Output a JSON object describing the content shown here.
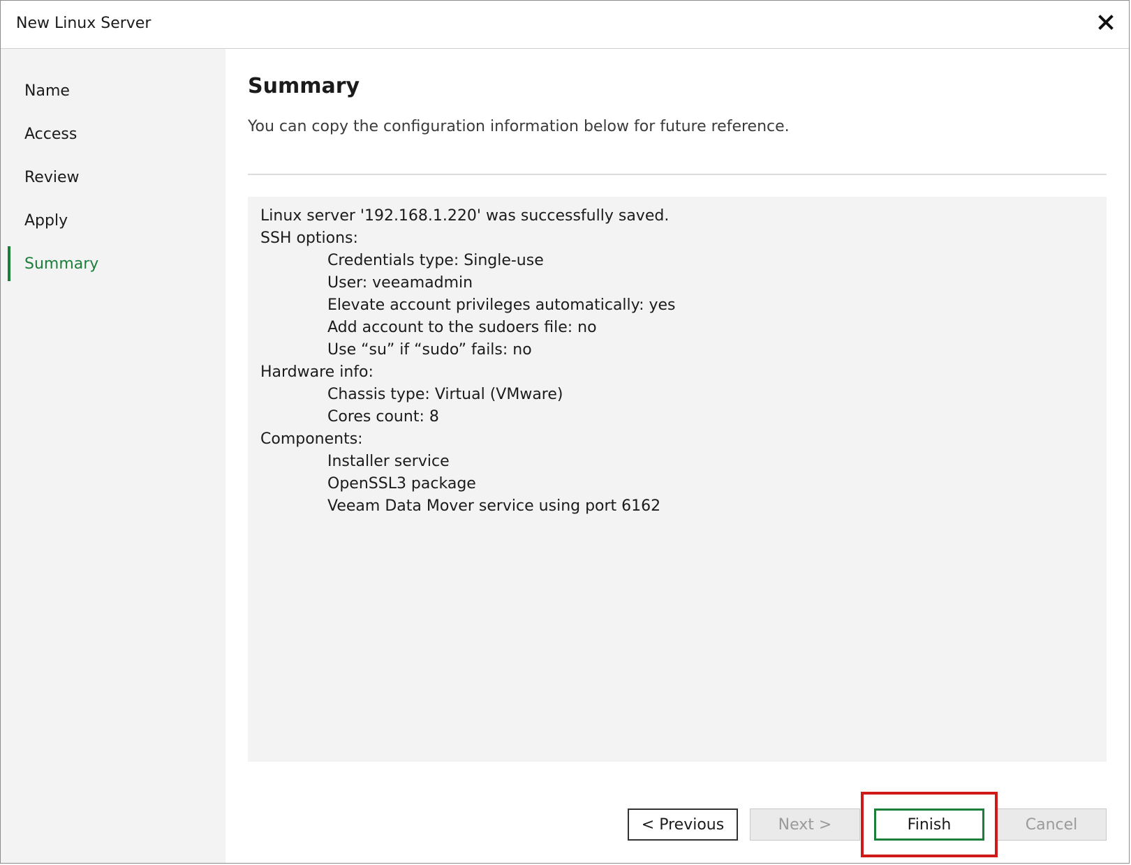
{
  "window": {
    "title": "New Linux Server",
    "close_icon": "close-icon"
  },
  "sidebar": {
    "items": [
      {
        "label": "Name",
        "active": false
      },
      {
        "label": "Access",
        "active": false
      },
      {
        "label": "Review",
        "active": false
      },
      {
        "label": "Apply",
        "active": false
      },
      {
        "label": "Summary",
        "active": true
      }
    ]
  },
  "main": {
    "title": "Summary",
    "subtitle": "You can copy the configuration information below for future reference.",
    "summary_lines": [
      {
        "text": "Linux server '192.168.1.220' was successfully saved.",
        "indent": false
      },
      {
        "text": "SSH options:",
        "indent": false
      },
      {
        "text": "Credentials type: Single-use",
        "indent": true
      },
      {
        "text": "User: veeamadmin",
        "indent": true
      },
      {
        "text": "Elevate account privileges automatically: yes",
        "indent": true
      },
      {
        "text": "Add account to the sudoers file: no",
        "indent": true
      },
      {
        "text": "Use “su” if “sudo” fails: no",
        "indent": true
      },
      {
        "text": "Hardware info:",
        "indent": false
      },
      {
        "text": "Chassis type: Virtual (VMware)",
        "indent": true
      },
      {
        "text": "Cores count: 8",
        "indent": true
      },
      {
        "text": "Components:",
        "indent": false
      },
      {
        "text": "Installer service",
        "indent": true
      },
      {
        "text": "OpenSSL3 package",
        "indent": true
      },
      {
        "text": "Veeam Data Mover service using port 6162",
        "indent": true
      }
    ]
  },
  "footer": {
    "previous_label": "< Previous",
    "next_label": "Next >",
    "finish_label": "Finish",
    "cancel_label": "Cancel"
  },
  "colors": {
    "accent_green": "#1b7f3a",
    "highlight_red": "#d01a1a"
  }
}
